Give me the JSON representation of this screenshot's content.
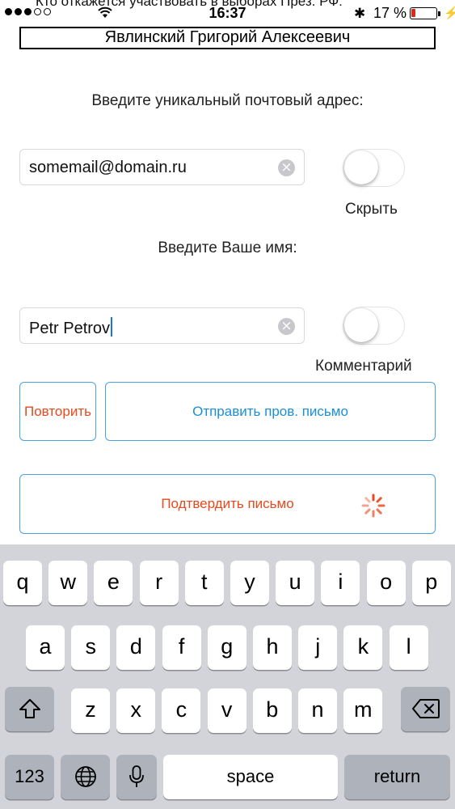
{
  "status_bar": {
    "carrier_text": "Кто откажется участвовать в выборах През. РФ:",
    "time": "16:37",
    "battery": "17 %",
    "battery_level_percent": 17,
    "colors": {
      "battery_low": "#e0251c"
    }
  },
  "candidate_name": "Явлинский Григорий Алексеевич",
  "email_section": {
    "prompt": "Введите уникальный почтовый адрес:",
    "value": "somemail@domain.ru",
    "toggle_label": "Скрыть",
    "toggle_on": false
  },
  "name_section": {
    "prompt": "Введите Ваше имя:",
    "value": "Petr Petrov",
    "toggle_label": "Комментарий",
    "toggle_on": false
  },
  "buttons": {
    "repeat": "Повторить",
    "send_check": "Отправить пров. письмо",
    "confirm": "Подтвердить письмо"
  },
  "colors": {
    "accent_blue": "#1a8fd8",
    "accent_red": "#e8491d",
    "border_blue": "#4aa2dd"
  },
  "keyboard": {
    "row1": [
      "q",
      "w",
      "e",
      "r",
      "t",
      "y",
      "u",
      "i",
      "o",
      "p"
    ],
    "row2": [
      "a",
      "s",
      "d",
      "f",
      "g",
      "h",
      "j",
      "k",
      "l"
    ],
    "row3": [
      "z",
      "x",
      "c",
      "v",
      "b",
      "n",
      "m"
    ],
    "numbers_key": "123",
    "space_key": "space",
    "return_key": "return",
    "icons": [
      "shift-icon",
      "backspace-icon",
      "globe-icon",
      "microphone-icon"
    ]
  }
}
